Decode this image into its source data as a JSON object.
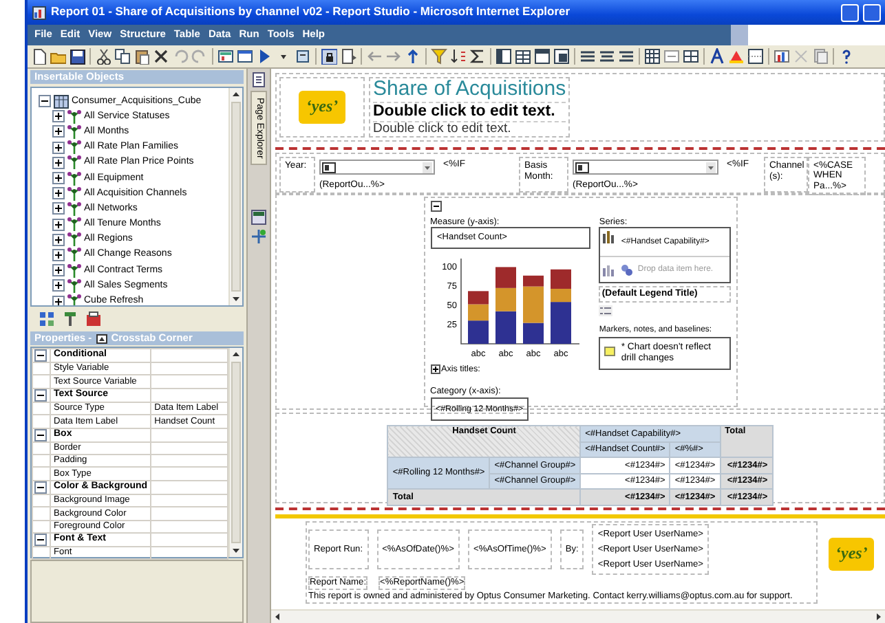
{
  "window": {
    "title": "Report 01 - Share of Acquisitions by channel v02 - Report Studio - Microsoft Internet Explorer"
  },
  "menu": [
    "File",
    "Edit",
    "View",
    "Structure",
    "Table",
    "Data",
    "Run",
    "Tools",
    "Help"
  ],
  "insertable_objects": {
    "title": "Insertable Objects",
    "tree": [
      {
        "label": "Consumer_Acquisitions_Cube",
        "expanded": true,
        "children": [
          {
            "label": "All Service Statuses",
            "expanded": false
          },
          {
            "label": "All Months",
            "expanded": false
          },
          {
            "label": "All Rate Plan Families",
            "expanded": false
          },
          {
            "label": "All Rate Plan Price Points",
            "expanded": false
          },
          {
            "label": "All Equipment",
            "expanded": false
          },
          {
            "label": "All Acquisition Channels",
            "expanded": false
          },
          {
            "label": "All Networks",
            "expanded": false
          },
          {
            "label": "All Tenure Months",
            "expanded": false
          },
          {
            "label": "All Regions",
            "expanded": false
          },
          {
            "label": "All Change Reasons",
            "expanded": false
          },
          {
            "label": "All Contract Terms",
            "expanded": false
          },
          {
            "label": "All Sales Segments",
            "expanded": false
          },
          {
            "label": "Cube Refresh",
            "expanded": false
          }
        ]
      }
    ]
  },
  "properties": {
    "title": "Properties -",
    "object": "Crosstab Corner",
    "groups": [
      {
        "name": "Conditional",
        "expanded": true,
        "rows": [
          {
            "property": "Style Variable"
          },
          {
            "property": "Text Source Variable"
          }
        ]
      },
      {
        "name": "Text Source",
        "expanded": true,
        "rows": [
          {
            "property": "Source Type",
            "value": "Data Item Label"
          },
          {
            "property": "Data Item Label",
            "value": "Handset Count"
          }
        ]
      },
      {
        "name": "Box",
        "expanded": true,
        "rows": [
          {
            "property": "Border"
          },
          {
            "property": "Padding"
          },
          {
            "property": "Box Type"
          }
        ]
      },
      {
        "name": "Color & Background",
        "expanded": true,
        "rows": [
          {
            "property": "Background Image"
          },
          {
            "property": "Background Color"
          },
          {
            "property": "Foreground Color"
          }
        ]
      },
      {
        "name": "Font & Text",
        "expanded": true,
        "rows": [
          {
            "property": "Font"
          }
        ]
      }
    ]
  },
  "page_explorer": {
    "label": "Page Explorer"
  },
  "report": {
    "header": {
      "logo": "‘yes’",
      "title": "Share of Acquisitions",
      "subtitle": "Double click to edit text.",
      "subtitle_2": "Double click to edit text."
    },
    "prompts": [
      {
        "label": "Year:",
        "expression": "<%IF",
        "value": "(ReportOu...%>"
      },
      {
        "label": "Basis Month:",
        "expression": "<%IF",
        "value": "(ReportOu...%>"
      },
      {
        "label": "Channel (s):",
        "expression": "<%CASE WHEN Pa...%>"
      }
    ],
    "chart": {
      "measure_label": "Measure (y-axis):",
      "measure": "<Handset Count>",
      "axis_titles": "Axis titles:",
      "category_label": "Category (x-axis):",
      "category": "<#Rolling 12 Months#>",
      "series_label": "Series:",
      "series": "<#Handset Capability#>",
      "drop_hint": "Drop data item here.",
      "legend_title": "(Default Legend Title)",
      "markers_label": "Markers, notes, and baselines:",
      "note": "* Chart doesn't reflect drill changes",
      "chart_data": {
        "type": "bar",
        "stacked": true,
        "categories": [
          "abc",
          "abc",
          "abc",
          "abc"
        ],
        "ylim": [
          0,
          110
        ],
        "yticks": [
          25,
          50,
          75,
          100
        ],
        "series": [
          {
            "color": "#2e3192",
            "values": [
              30,
              42,
              27,
              54
            ]
          },
          {
            "color": "#d4952b",
            "values": [
              21,
              30,
              47,
              17
            ]
          },
          {
            "color": "#9e2a2b",
            "values": [
              17,
              27,
              14,
              25
            ]
          }
        ]
      }
    },
    "crosstab": {
      "corner": "Handset Count",
      "column_header": "<#Handset Capability#>",
      "sub_columns": [
        "<#Handset Count#>",
        "<#%#>"
      ],
      "total_header": "Total",
      "row_header": "<#Rolling 12 Months#>",
      "rows": [
        {
          "group": "<#Channel Group#>",
          "cells": [
            "<#1234#>",
            "<#1234#>",
            "<#1234#>"
          ]
        },
        {
          "group": "<#Channel Group#>",
          "cells": [
            "<#1234#>",
            "<#1234#>",
            "<#1234#>"
          ]
        }
      ],
      "total_row": {
        "label": "Total",
        "cells": [
          "<#1234#>",
          "<#1234#>",
          "<#1234#>"
        ]
      }
    },
    "footer": {
      "run_label": "Report Run:",
      "date": "<%AsOfDate()%>",
      "time": "<%AsOfTime()%>",
      "by_label": "By:",
      "users": [
        "<Report User UserName>",
        "<Report User UserName>",
        "<Report User UserName>"
      ],
      "name_label": "Report Name:",
      "name": "<%ReportName()%>",
      "notice": "This report is owned and administered by Optus Consumer Marketing. Contact  kerry.williams@optus.com.au for support.",
      "logo": "‘yes’"
    }
  }
}
